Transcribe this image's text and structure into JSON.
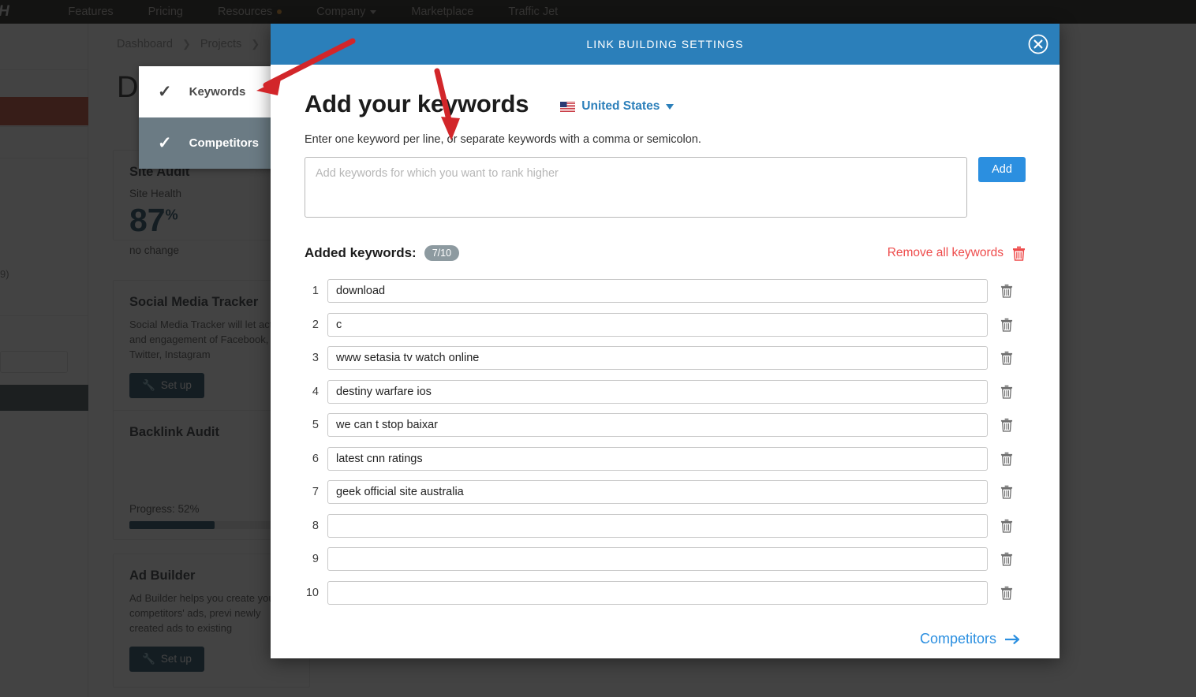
{
  "topnav": {
    "logo": "SH",
    "links": [
      {
        "label": "Features",
        "has_badge": false,
        "has_caret": false
      },
      {
        "label": "Pricing",
        "has_badge": false,
        "has_caret": false
      },
      {
        "label": "Resources",
        "has_badge": true,
        "has_caret": false
      },
      {
        "label": "Company",
        "has_badge": false,
        "has_caret": true
      },
      {
        "label": "Marketplace",
        "has_badge": false,
        "has_caret": false
      },
      {
        "label": "Traffic Jet",
        "has_badge": false,
        "has_caret": false
      }
    ]
  },
  "background": {
    "breadcrumb": [
      "Dashboard",
      "Projects"
    ],
    "breadcrumb_sep": "❯",
    "page_title": "D",
    "rail_label": "9)",
    "cards": [
      {
        "title": "Site Audit",
        "metric_label": "Site Health",
        "metric_value": "87",
        "metric_unit": "%",
        "metric_delta": "no change"
      },
      {
        "title": "Social Media Tracker",
        "body": "Social Media Tracker will let activity and engagement of Facebook, Twitter, Instagram",
        "button": "Set up"
      },
      {
        "title": "Backlink Audit",
        "progress_label": "Progress: 52%",
        "progress_pct": 52
      },
      {
        "title": "Ad Builder",
        "body": "Ad Builder helps you create your competitors' ads, previ newly created ads to existing",
        "button": "Set up"
      }
    ]
  },
  "flyout": {
    "items": [
      {
        "label": "Keywords",
        "checked": true,
        "active": true
      },
      {
        "label": "Competitors",
        "checked": true,
        "active": false
      }
    ]
  },
  "modal": {
    "header_title": "LINK BUILDING SETTINGS",
    "close_icon": "close-circle-icon",
    "heading": "Add your keywords",
    "country": {
      "name": "United States",
      "flag": "us-flag-icon"
    },
    "subtitle": "Enter one keyword per line, or separate keywords with a comma or semicolon.",
    "textarea_placeholder": "Add keywords for which you want to rank higher",
    "textarea_value": "",
    "add_button": "Add",
    "added_label": "Added keywords:",
    "added_count": "7/10",
    "remove_all_label": "Remove all keywords",
    "remove_all_icon": "trash-icon",
    "row_delete_icon": "trash-icon",
    "keywords": [
      {
        "index": "1",
        "value": "download"
      },
      {
        "index": "2",
        "value": "c"
      },
      {
        "index": "3",
        "value": "www setasia tv watch online"
      },
      {
        "index": "4",
        "value": "destiny warfare ios"
      },
      {
        "index": "5",
        "value": "we can t stop baixar"
      },
      {
        "index": "6",
        "value": "latest cnn ratings"
      },
      {
        "index": "7",
        "value": "geek official site australia"
      },
      {
        "index": "8",
        "value": ""
      },
      {
        "index": "9",
        "value": ""
      },
      {
        "index": "10",
        "value": ""
      }
    ],
    "next_link": "Competitors",
    "next_icon": "arrow-right-icon"
  },
  "annotations": {
    "arrow_color": "#d2262a",
    "arrows": [
      {
        "name": "arrow-to-keywords-tab",
        "points_to": "flyout Keywords item"
      },
      {
        "name": "arrow-to-keyword-textarea",
        "points_to": "keyword entry textarea"
      }
    ]
  },
  "colors": {
    "modal_header": "#2b7fba",
    "accent_blue": "#2b8fe0",
    "danger_red": "#ee4b4b",
    "dark_navy": "#16415c",
    "flyout_inactive": "#6b7b84",
    "count_pill": "#8d9aa0"
  }
}
